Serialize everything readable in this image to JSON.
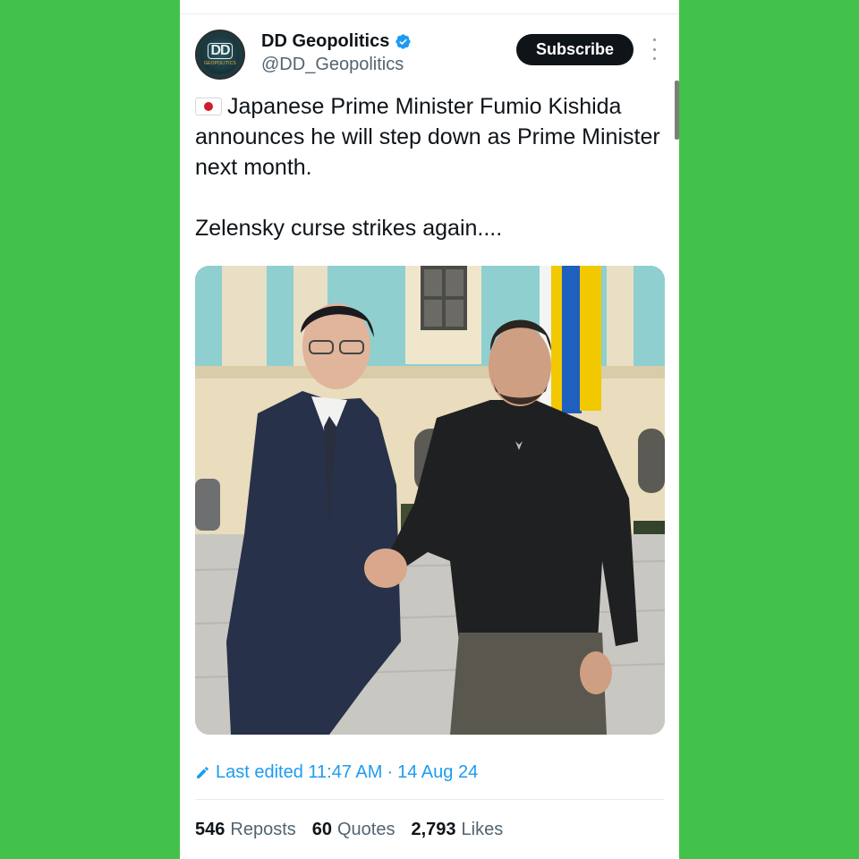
{
  "colors": {
    "background": "#42c24a",
    "card": "#ffffff",
    "text_primary": "#0f1419",
    "text_secondary": "#536471",
    "link_blue": "#1d9bf0",
    "subscribe_bg": "#0f1419"
  },
  "header": {
    "display_name": "DD Geopolitics",
    "handle": "@DD_Geopolitics",
    "avatar_text": "DD",
    "avatar_subtext": "GEOPOLITICS",
    "verified_icon": "verified-badge-icon",
    "subscribe_label": "Subscribe",
    "more_icon": "more-vertical-icon"
  },
  "tweet": {
    "flag_icon": "japan-flag-icon",
    "line1": "Japanese Prime Minister Fumio Kishida announces he will step down as Prime Minister next month.",
    "line2": "Zelensky curse strikes again....",
    "photo_alt": "Fumio Kishida and Volodymyr Zelensky shaking hands in front of a building with a Ukrainian flag"
  },
  "edited": {
    "icon": "pencil-icon",
    "label": "Last edited 11:47 AM",
    "separator": "·",
    "date": "14 Aug 24"
  },
  "stats": {
    "reposts_count": "546",
    "reposts_label": "Reposts",
    "quotes_count": "60",
    "quotes_label": "Quotes",
    "likes_count": "2,793",
    "likes_label": "Likes"
  }
}
